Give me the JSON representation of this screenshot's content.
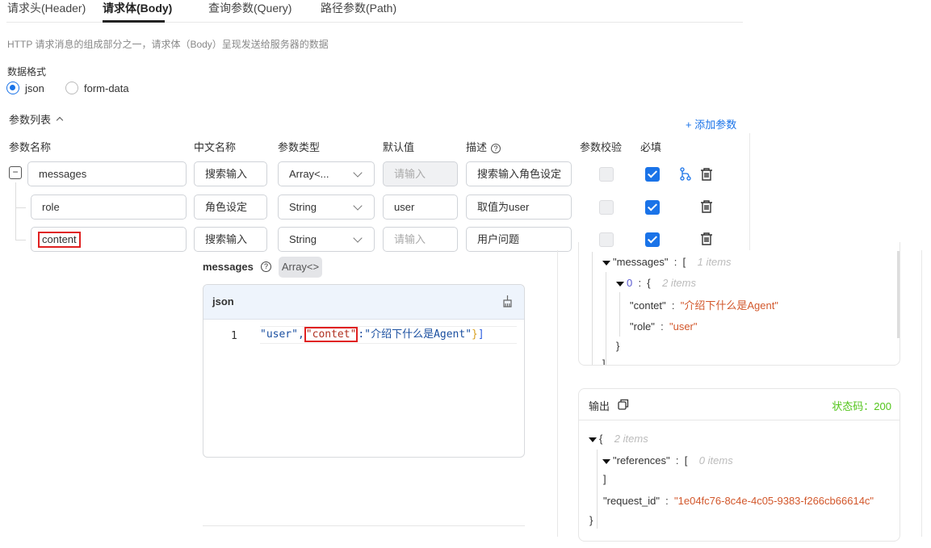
{
  "tabs": [
    {
      "label": "请求头(Header)"
    },
    {
      "label": "请求体(Body)"
    },
    {
      "label": "查询参数(Query)"
    },
    {
      "label": "路径参数(Path)"
    }
  ],
  "description": "HTTP 请求消息的组成部分之一，请求体（Body）呈现发送给服务器的数据",
  "format": {
    "label": "数据格式",
    "options": [
      {
        "label": "json",
        "selected": true
      },
      {
        "label": "form-data",
        "selected": false
      }
    ]
  },
  "params": {
    "title": "参数列表",
    "add_label": "+ 添加参数",
    "headers": [
      "参数名称",
      "中文名称",
      "参数类型",
      "默认值",
      "描述",
      "参数校验",
      "必填"
    ],
    "rows": [
      {
        "name": "messages",
        "cn": "搜索输入",
        "type": "Array<...",
        "default": "",
        "default_placeholder": "请输入",
        "desc": "搜索输入角色设定",
        "validate": false,
        "required": true
      },
      {
        "name": "role",
        "cn": "角色设定",
        "type": "String",
        "default": "user",
        "default_placeholder": "请输入",
        "desc": "取值为user",
        "validate": false,
        "required": true
      },
      {
        "name": "content",
        "cn": "搜索输入",
        "type": "String",
        "default": "",
        "default_placeholder": "请输入",
        "desc": "用户问题",
        "validate": false,
        "required": true
      }
    ]
  },
  "editor": {
    "field": "messages",
    "type_badge": "Array<>",
    "lang": "json",
    "line_no": "1",
    "code": {
      "p1": "\"user\",",
      "p2": "\"contet\"",
      "p3": ":\"介绍下什么是Agent\"",
      "p4": "}",
      "p5": "]"
    }
  },
  "input_preview": {
    "key": "\"messages\"",
    "bracket": "[",
    "count": "1 items",
    "idx": "0",
    "brace": "{",
    "count2": "2 items",
    "fields": [
      {
        "k": "\"contet\"",
        "v": "\"介绍下什么是Agent\""
      },
      {
        "k": "\"role\"",
        "v": "\"user\""
      }
    ],
    "close": "}",
    "close2": "]"
  },
  "output": {
    "title": "输出",
    "status": "状态码：200",
    "brace": "{",
    "count": "2 items",
    "refs_key": "\"references\"",
    "refs_bracket": "[",
    "refs_count": "0 items",
    "refs_close": "]",
    "rid_key": "\"request_id\"",
    "rid_val": "\"1e04fc76-8c4e-4c05-9383-f266cb66614c\"",
    "close": "}"
  },
  "colors": {
    "accent": "#1a73e8",
    "status": "#52c41a",
    "string": "#d2572b",
    "highlight": "#e02020"
  }
}
